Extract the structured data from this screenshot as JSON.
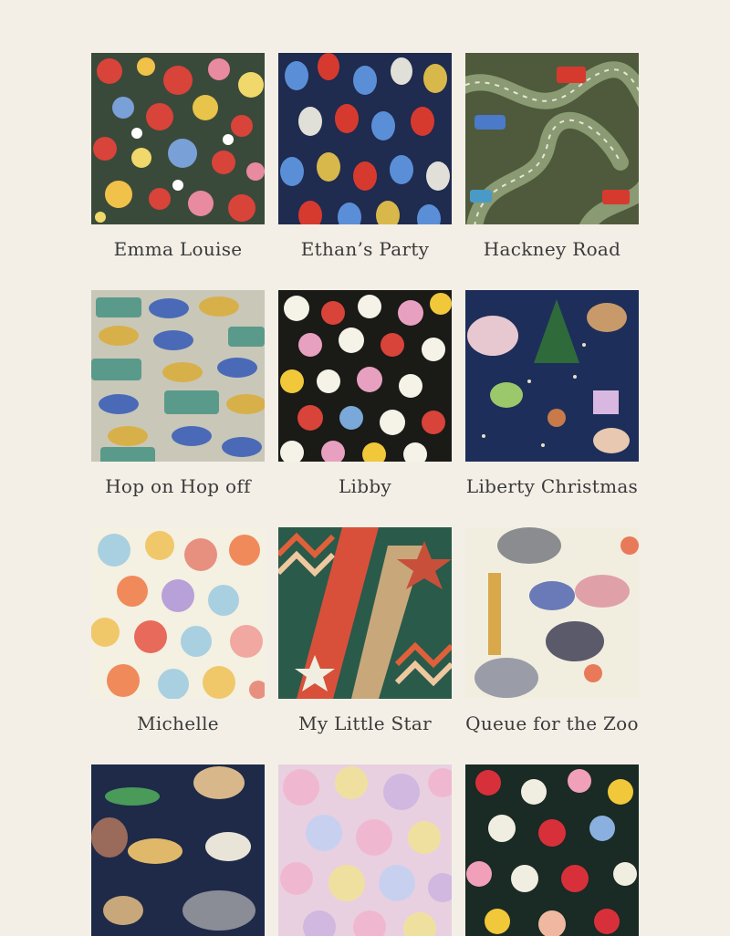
{
  "products": [
    {
      "name": "Emma Louise",
      "swatch": "red-floral-pattern"
    },
    {
      "name": "Ethan’s Party",
      "swatch": "balloon-pattern"
    },
    {
      "name": "Hackney Road",
      "swatch": "road-car-pattern"
    },
    {
      "name": "Hop on Hop off",
      "swatch": "bus-car-pattern"
    },
    {
      "name": "Libby",
      "swatch": "daisy-pattern"
    },
    {
      "name": "Liberty Christmas",
      "swatch": "christmas-animal-pattern"
    },
    {
      "name": "Michelle",
      "swatch": "pastel-floral-pattern"
    },
    {
      "name": "My Little Star",
      "swatch": "star-chevron-pattern"
    },
    {
      "name": "Queue for the Zoo",
      "swatch": "zoo-animal-pattern"
    },
    {
      "name": "",
      "swatch": "safari-animal-pattern"
    },
    {
      "name": "",
      "swatch": "pink-floral-pattern"
    },
    {
      "name": "",
      "swatch": "dark-floral-pattern"
    }
  ],
  "colors": {
    "background": "#f3efe6",
    "label": "#3a3a3a"
  }
}
